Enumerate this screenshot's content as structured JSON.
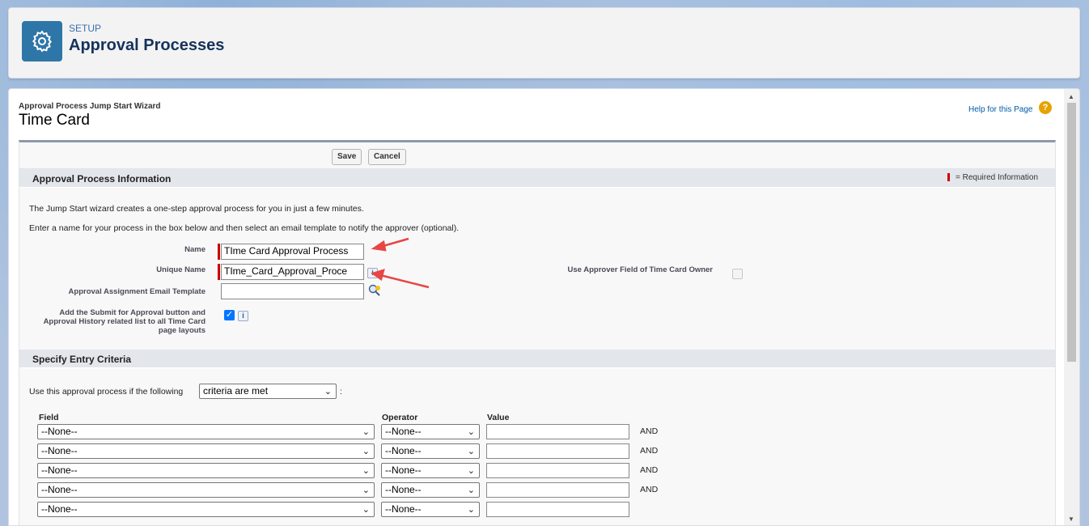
{
  "header": {
    "section": "SETUP",
    "title": "Approval Processes"
  },
  "page": {
    "wizard_label": "Approval Process Jump Start Wizard",
    "title": "Time Card",
    "help_link": "Help for this Page",
    "help_icon_glyph": "?"
  },
  "buttons": {
    "save": "Save",
    "cancel": "Cancel"
  },
  "approval_info": {
    "section_title": "Approval Process Information",
    "required_info": "= Required Information",
    "intro1": "The Jump Start wizard creates a one-step approval process for you in just a few minutes.",
    "intro2": "Enter a name for your process in the box below and then select an email template to notify the approver (optional).",
    "name_label": "Name",
    "name_value": "TIme Card Approval Process",
    "unique_name_label": "Unique Name",
    "unique_name_value": "TIme_Card_Approval_Proce",
    "email_template_label": "Approval Assignment Email Template",
    "email_template_value": "",
    "submit_label": "Add the Submit for Approval button and Approval History related list to all Time Card page layouts",
    "submit_checked": true,
    "approver_field_label": "Use Approver Field of Time Card Owner",
    "approver_field_checked": false,
    "info_glyph": "i"
  },
  "entry_criteria": {
    "section_title": "Specify Entry Criteria",
    "use_text": "Use this approval process if the following",
    "criteria_select": "criteria are met",
    "colon": ":",
    "field_header": "Field",
    "operator_header": "Operator",
    "value_header": "Value",
    "rows": [
      {
        "field": "--None--",
        "operator": "--None--",
        "value": "",
        "conj": "AND"
      },
      {
        "field": "--None--",
        "operator": "--None--",
        "value": "",
        "conj": "AND"
      },
      {
        "field": "--None--",
        "operator": "--None--",
        "value": "",
        "conj": "AND"
      },
      {
        "field": "--None--",
        "operator": "--None--",
        "value": "",
        "conj": "AND"
      },
      {
        "field": "--None--",
        "operator": "--None--",
        "value": "",
        "conj": ""
      }
    ]
  },
  "colors": {
    "brand_icon": "#2f76a8",
    "required": "#cc0000",
    "annotation_arrow": "#e84545",
    "checkbox_checked": "#0075ff"
  }
}
